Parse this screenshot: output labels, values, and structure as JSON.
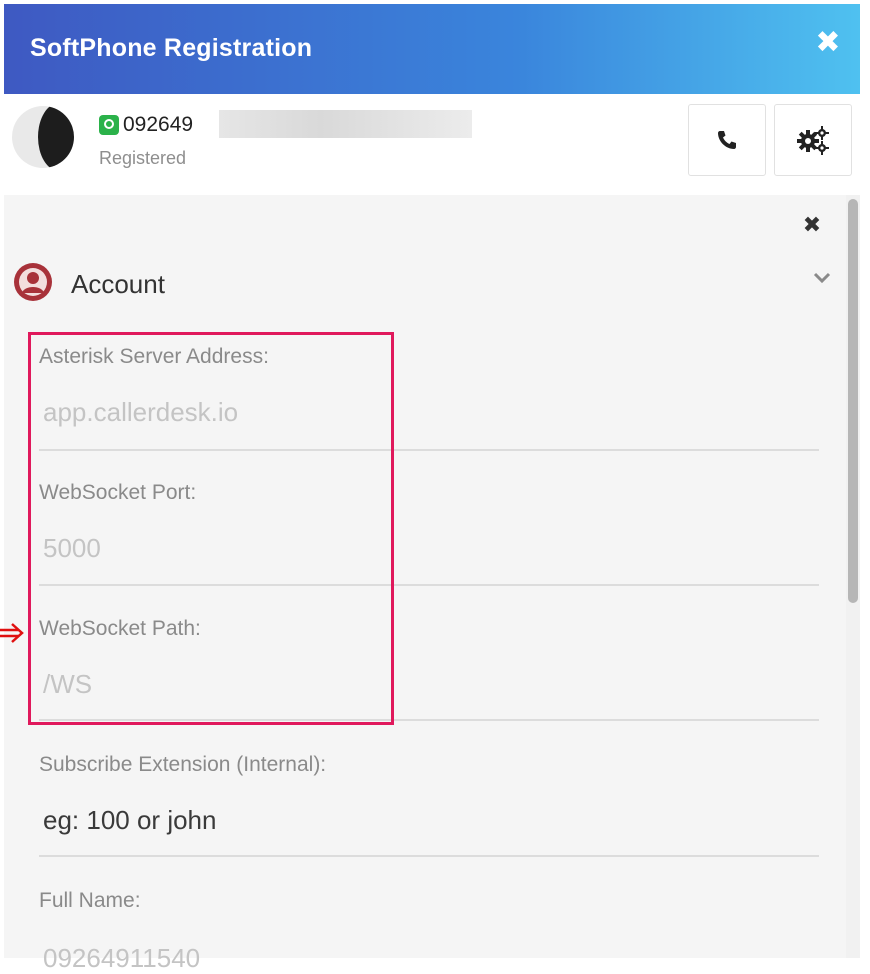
{
  "window": {
    "title": "SoftPhone Registration"
  },
  "status": {
    "phone_number": "092649",
    "registration": "Registered"
  },
  "account": {
    "section_title": "Account",
    "fields": [
      {
        "label": "Asterisk Server Address:",
        "placeholder": "app.callerdesk.io"
      },
      {
        "label": "WebSocket Port:",
        "placeholder": "5000"
      },
      {
        "label": "WebSocket Path:",
        "placeholder": "/WS"
      },
      {
        "label": "Subscribe Extension (Internal):",
        "placeholder": "eg: 100 or john"
      },
      {
        "label": "Full Name:",
        "placeholder": "09264911540"
      }
    ]
  },
  "icons": {
    "close": "close-icon",
    "call": "phone-icon",
    "settings": "gears-icon",
    "account": "user-circle-icon",
    "collapse": "chevron-down-icon",
    "whatsapp": "whatsapp-icon"
  },
  "colors": {
    "header_start": "#3e59c2",
    "header_end": "#4fc1f0",
    "highlight": "#e0195c",
    "account_icon": "#a8323a"
  }
}
